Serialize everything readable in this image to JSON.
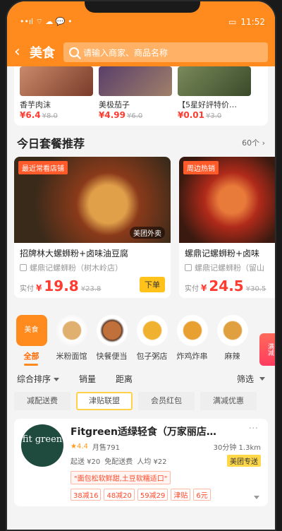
{
  "status": {
    "left": "••ıl ⌔ ☁ 💬 •",
    "time": "11:52"
  },
  "header": {
    "back_icon": "back-arrow-icon",
    "title": "美食",
    "search_placeholder": "请输入商家、商品名称"
  },
  "top_items": [
    {
      "name": "香芋肉沫",
      "price": "¥6.4",
      "old": "¥8.0"
    },
    {
      "name": "美极茄子",
      "price": "¥4.99",
      "old": "¥6.0"
    },
    {
      "name": "【5星好評特价…",
      "price": "¥0.01",
      "old": "¥3.0"
    }
  ],
  "combo_section": {
    "title": "今日套餐推荐",
    "more": "60个 ›"
  },
  "combos": [
    {
      "tag": "最近常看店铺",
      "watermark": "美团外卖",
      "name": "招牌林大螺蛳粉+卤味油豆腐",
      "shop": "螺鼎记螺蛳粉（树木岭店）",
      "price_label": "实付",
      "currency": "¥",
      "price": "19.8",
      "orig": "¥23.8",
      "order": "下单"
    },
    {
      "tag": "周边热销",
      "watermark": "",
      "name": "螺鼎记螺蛳粉+卤味",
      "shop": "螺鼎记螺蛳粉（留山",
      "price_label": "实付",
      "currency": "¥",
      "price": "24.5",
      "orig": "¥30.5",
      "order": ""
    }
  ],
  "categories": [
    {
      "label": "全部",
      "badge": "美食"
    },
    {
      "label": "米粉面馆"
    },
    {
      "label": "快餐便当"
    },
    {
      "label": "包子粥店"
    },
    {
      "label": "炸鸡炸串"
    },
    {
      "label": "麻辣"
    }
  ],
  "sort": {
    "comprehensive": "综合排序",
    "sales": "销量",
    "distance": "距离",
    "filter": "筛选"
  },
  "chips": [
    "减配送费",
    "津贴联盟",
    "会员红包",
    "满减优惠"
  ],
  "side_promo": "满减",
  "shop": {
    "logo": "fit green",
    "name": "Fitgreen适绿轻食（万家丽店…",
    "rating": "★4.4",
    "monthly": "月售791",
    "time_dist": "30分钟  1.3km",
    "min_order": "起送 ¥20",
    "delivery": "免配送费",
    "avg": "人均 ¥22",
    "badge": "美团专送",
    "promo": "\"面包松软鲜甜,土豆软糯适口\"",
    "discounts": [
      "38减16",
      "48减20",
      "59减29",
      "津贴",
      "6元"
    ]
  },
  "colors": {
    "brand": "#ff8a1e",
    "price": "#ff3b2f",
    "order_button": "#ffc21a"
  }
}
